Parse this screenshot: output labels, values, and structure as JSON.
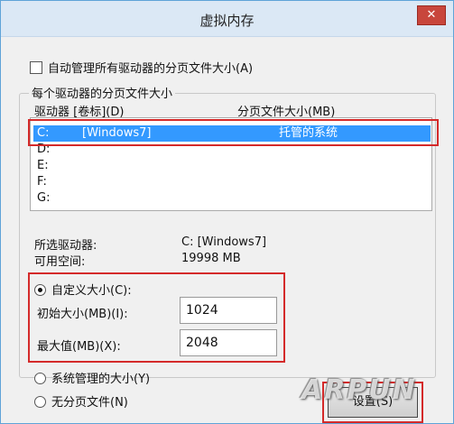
{
  "window": {
    "title": "虚拟内存",
    "close_glyph": "✕"
  },
  "auto_manage": {
    "label": "自动管理所有驱动器的分页文件大小(A)",
    "checked": false
  },
  "group": {
    "legend": "每个驱动器的分页文件大小"
  },
  "list": {
    "header_drive": "驱动器 [卷标](D)",
    "header_size": "分页文件大小(MB)",
    "rows": [
      {
        "drive": "C:",
        "label": "[Windows7]",
        "size": "托管的系统"
      },
      {
        "drive": "D:",
        "label": "",
        "size": ""
      },
      {
        "drive": "E:",
        "label": "",
        "size": ""
      },
      {
        "drive": "F:",
        "label": "",
        "size": ""
      },
      {
        "drive": "G:",
        "label": "",
        "size": ""
      }
    ]
  },
  "selected": {
    "drive_label": "所选驱动器:",
    "drive_value": "C:  [Windows7]",
    "space_label": "可用空间:",
    "space_value": "19998 MB"
  },
  "custom": {
    "label": "自定义大小(C):",
    "initial_label": "初始大小(MB)(I):",
    "initial_value": "1024",
    "max_label": "最大值(MB)(X):",
    "max_value": "2048"
  },
  "system_managed": {
    "label": "系统管理的大小(Y)"
  },
  "no_paging": {
    "label": "无分页文件(N)"
  },
  "set_button": {
    "label": "设置(S)"
  },
  "watermark": {
    "text": "ARPUN"
  },
  "colors": {
    "selection": "#3399ff",
    "highlight_box": "#d42a2a",
    "title_bar": "#dbe8f5"
  }
}
